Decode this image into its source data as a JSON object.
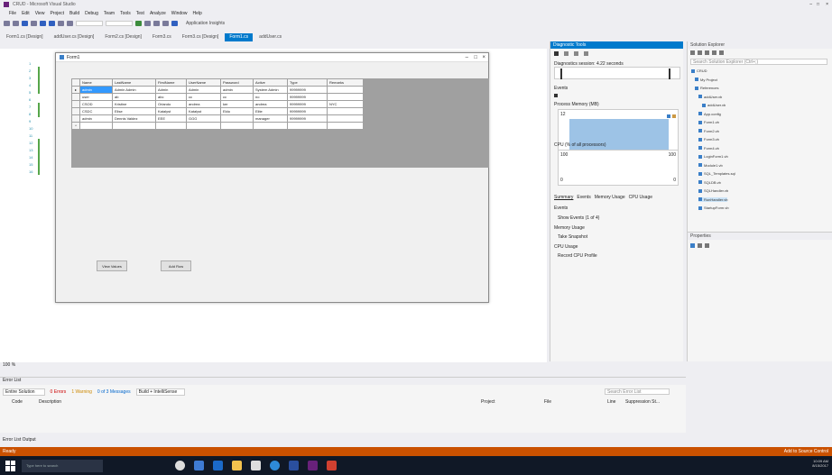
{
  "window": {
    "title": "CRUD - Microsoft Visual Studio"
  },
  "menu": [
    "File",
    "Edit",
    "View",
    "Project",
    "Build",
    "Debug",
    "Team",
    "Tools",
    "Test",
    "Analyze",
    "Window",
    "Help"
  ],
  "toolbar": {
    "run_label": "Application Insights"
  },
  "doc_tabs": [
    "Form1.cs [Design]",
    "addUser.cs [Design]",
    "Form2.cs [Design]",
    "Form3.cs",
    "Form3.cs [Design]",
    "Form1.cs",
    "addUser.cs"
  ],
  "form": {
    "title": "Form1",
    "grid": {
      "columns": [
        "Name",
        "LastName",
        "FirstName",
        "UserName",
        "Password",
        "Active",
        "Type",
        "Remarks"
      ],
      "rows": [
        [
          "admin",
          "Admin Admin",
          "Admin",
          "Admin",
          "admin",
          "System Admin",
          "99999999",
          ""
        ],
        [
          "user",
          "ab",
          "abc",
          "cc",
          "cc",
          "no",
          "99999999",
          ""
        ],
        [
          "CSOD",
          "Kristine",
          "Orlando",
          "andrea",
          "ker",
          "andrea",
          "99999999",
          "NYC"
        ],
        [
          "CSDC",
          "Elise",
          "Katalyst",
          "Katalyst",
          "Eldo",
          "Elite",
          "99999999",
          ""
        ],
        [
          "admin",
          "Dennis Valdez",
          "EEE",
          "GGG",
          "",
          "manager",
          "99999999",
          ""
        ]
      ]
    },
    "buttons": {
      "view": "View Values",
      "add": "Add Row"
    }
  },
  "diagnostics": {
    "title": "Diagnostic Tools",
    "session": "Diagnostics session: 4.22 seconds",
    "events": "Events",
    "memory_label": "Process Memory (MB)",
    "cpu_label": "CPU (% of all processors)",
    "memory_value": "12",
    "cpu_max": "100",
    "cpu_min": "0",
    "tabs": [
      "Summary",
      "Events",
      "Memory Usage",
      "CPU Usage"
    ],
    "events_section": "Events",
    "show_events": "Show Events (1 of 4)",
    "memory_usage": "Memory Usage",
    "snapshot": "Take Snapshot",
    "cpu_usage": "CPU Usage",
    "record_cpu": "Record CPU Profile",
    "zoom": "100 %"
  },
  "solution": {
    "title": "Solution Explorer",
    "search": "Search Solution Explorer (Ctrl+;)",
    "items": [
      "CRUD",
      "My Project",
      "References",
      "addUser.vb",
      "addUser.vb",
      "App.config",
      "Form1.vb",
      "Form2.vb",
      "Form3.vb",
      "Form4.vb",
      "LoginForm1.vb",
      "Module1.vb",
      "SQL_Templates.sql",
      "SQLDB.vb",
      "SQLHandler.vb",
      "RunHandler.vb",
      "StartupForm.vb"
    ]
  },
  "properties": {
    "title": "Properties"
  },
  "error_list": {
    "title": "Error List",
    "scope": "Entire Solution",
    "errors": "0 Errors",
    "warnings": "1 Warning",
    "messages": "0 of 3 Messages",
    "build": "Build + IntelliSense",
    "search": "Search Error List",
    "cols": [
      "Code",
      "Description",
      "Project",
      "File",
      "Line",
      "Suppression St..."
    ]
  },
  "output_tabs": "Error List  Output",
  "status": {
    "left": "Ready",
    "right": "Add to Source Control"
  },
  "taskbar": {
    "search": "Type here to search",
    "time": "10:09 AM",
    "date": "8/15/2017"
  }
}
